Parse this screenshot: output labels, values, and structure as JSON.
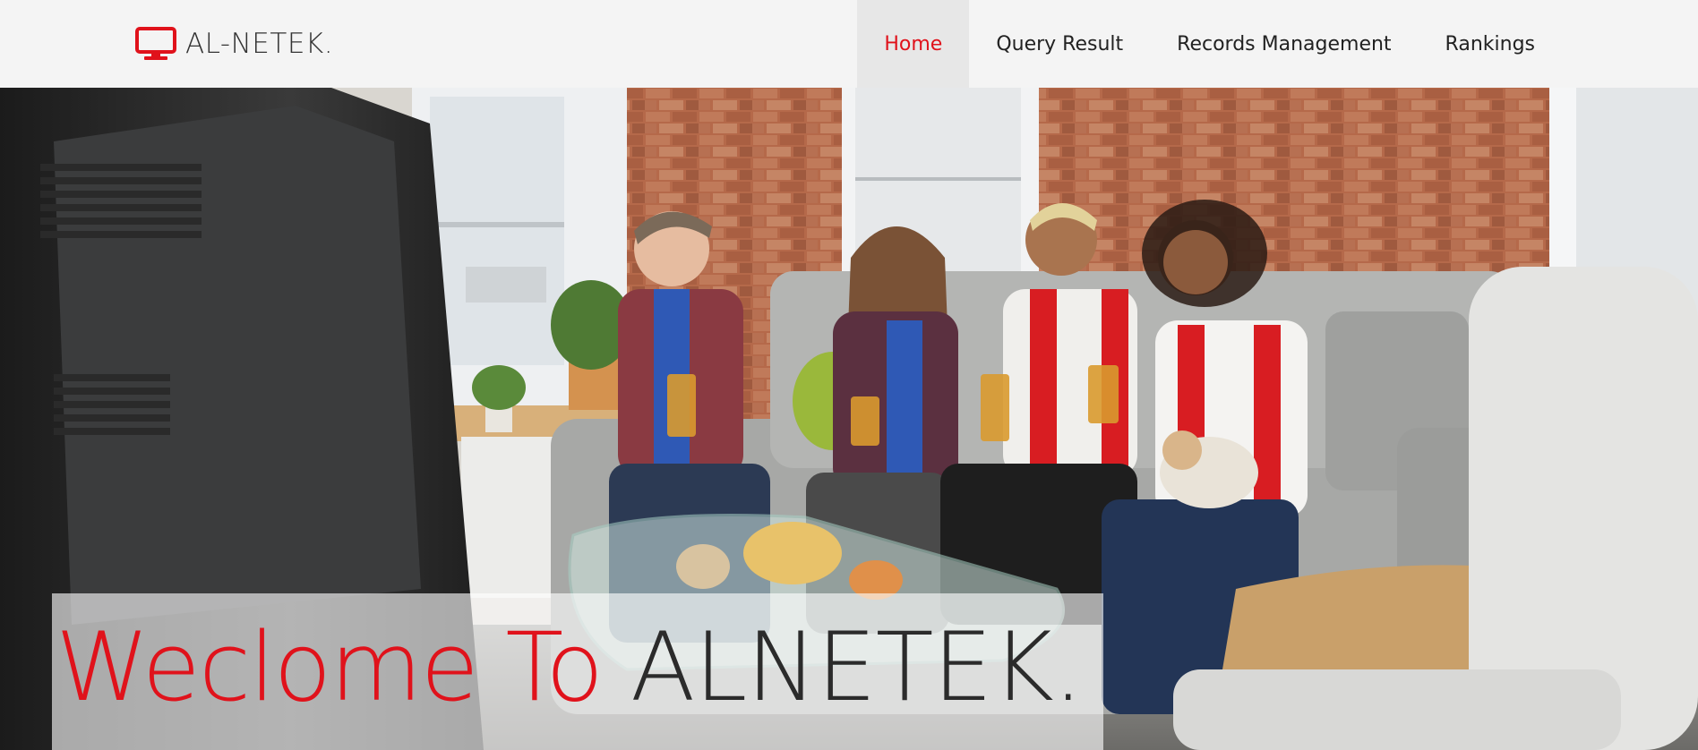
{
  "brand": {
    "name": "AL-NETEK.",
    "icon": "monitor-icon",
    "color": "#e0121b"
  },
  "nav": {
    "items": [
      {
        "label": "Home",
        "active": true
      },
      {
        "label": "Query Result",
        "active": false
      },
      {
        "label": "Records Management",
        "active": false
      },
      {
        "label": "Rankings",
        "active": false
      }
    ]
  },
  "hero": {
    "image": "friends-watching-tv-photo",
    "heading_red": "Weclome To",
    "heading_dark": "ALNETEK."
  },
  "colors": {
    "accent": "#e0121b",
    "navbar_bg": "#f4f4f4",
    "active_bg": "#e7e7e7"
  }
}
